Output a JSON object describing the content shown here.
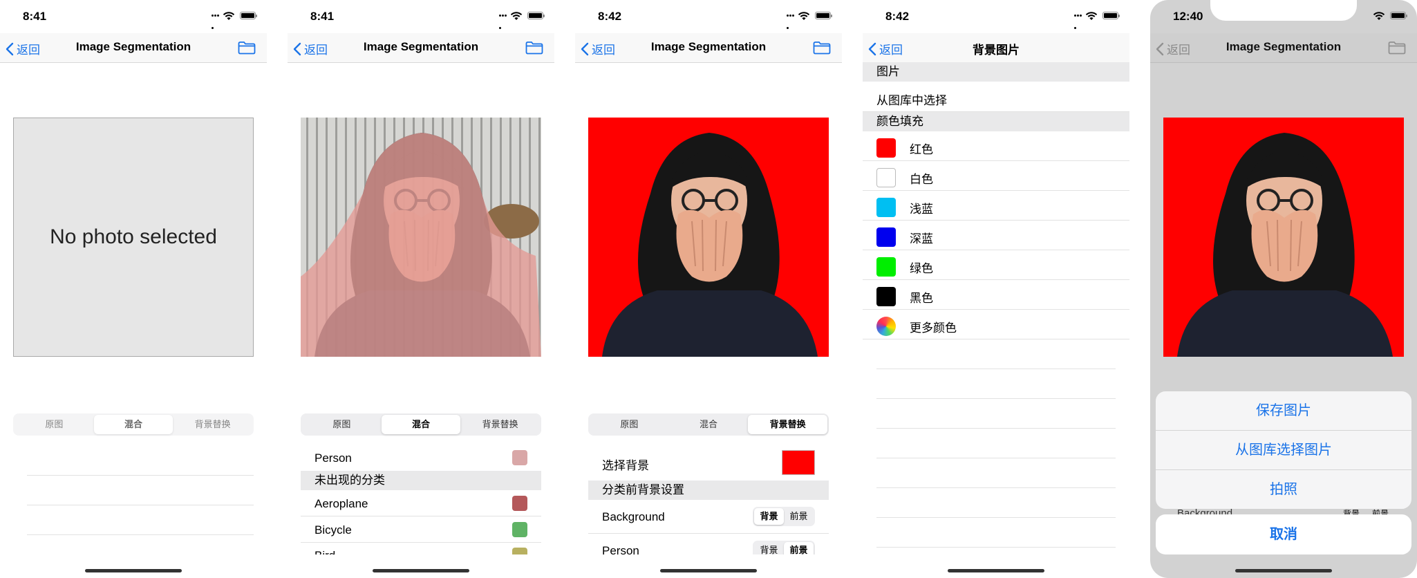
{
  "common": {
    "back_label": "返回",
    "title": "Image Segmentation"
  },
  "screen1": {
    "time": "8:41",
    "placeholder": "No photo selected",
    "segments": [
      "原图",
      "混合",
      "背景替换"
    ]
  },
  "screen2": {
    "time": "8:41",
    "segments": [
      "原图",
      "混合",
      "背景替换"
    ],
    "rows": [
      {
        "label": "Person",
        "color": "#d9a7a7"
      }
    ],
    "section": "未出现的分类",
    "more_rows": [
      {
        "label": "Aeroplane",
        "color": "#b4585a"
      },
      {
        "label": "Bicycle",
        "color": "#5fb365"
      },
      {
        "label": "Bird",
        "color": "#b8b060"
      }
    ]
  },
  "screen3": {
    "time": "8:42",
    "segments": [
      "原图",
      "混合",
      "背景替换"
    ],
    "choose_bg_label": "选择背景",
    "choose_bg_color": "#ff0000",
    "section": "分类前背景设置",
    "rows": [
      {
        "label": "Background",
        "options": [
          "背景",
          "前景"
        ],
        "selected": 0
      },
      {
        "label": "Person",
        "options": [
          "背景",
          "前景"
        ],
        "selected": 1
      }
    ]
  },
  "screen4": {
    "time": "8:42",
    "title": "背景图片",
    "section_image": "图片",
    "choose_from_library": "从图库中选择",
    "section_color": "颜色填充",
    "colors": [
      {
        "label": "红色",
        "color": "#ff0000"
      },
      {
        "label": "白色",
        "color": "#ffffff"
      },
      {
        "label": "浅蓝",
        "color": "#00bff2"
      },
      {
        "label": "深蓝",
        "color": "#0000ee"
      },
      {
        "label": "绿色",
        "color": "#00ee00"
      },
      {
        "label": "黑色",
        "color": "#000000"
      },
      {
        "label": "更多颜色",
        "color": "multicolor"
      }
    ]
  },
  "screen5": {
    "time": "12:40",
    "partial_row_label": "Background",
    "partial_options": [
      "背景",
      "前景"
    ],
    "actions": [
      "保存图片",
      "从图库选择图片",
      "拍照"
    ],
    "cancel": "取消"
  },
  "colors": {
    "accent": "#1a73e8",
    "red_bg": "#ff0000"
  }
}
